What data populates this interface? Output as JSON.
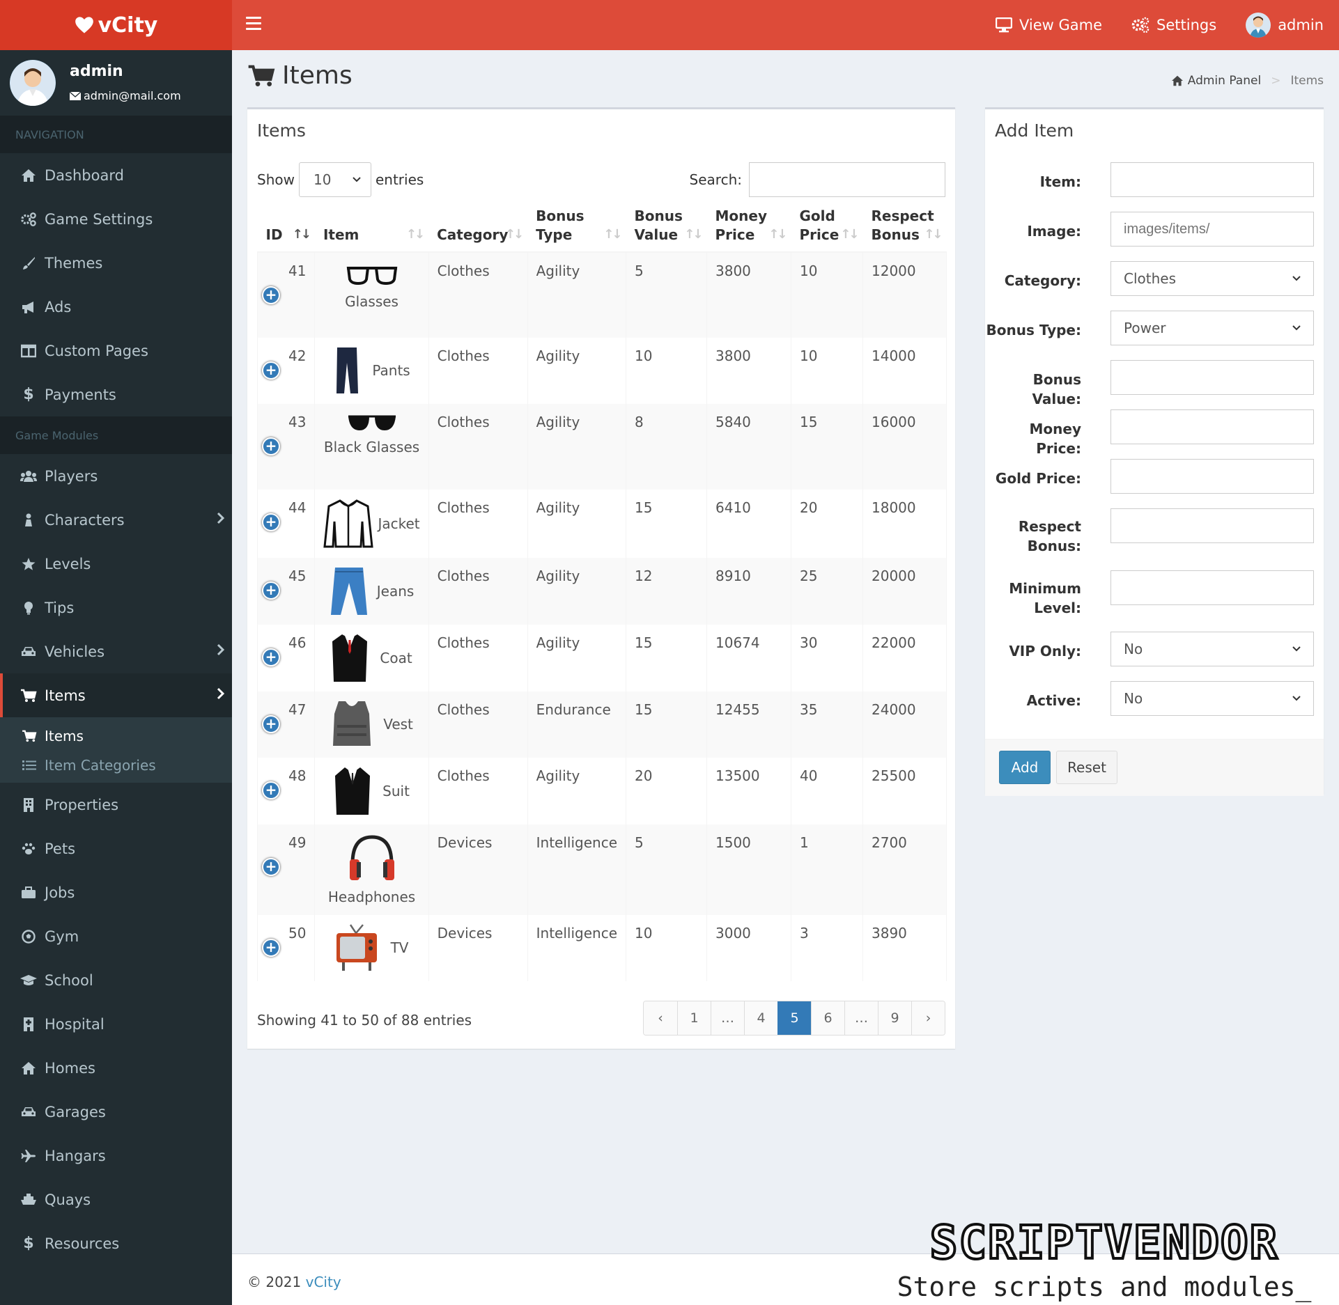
{
  "app": {
    "name": "vCity"
  },
  "topnav": {
    "view_game": "View Game",
    "settings": "Settings",
    "user": "admin"
  },
  "user": {
    "name": "admin",
    "email": "admin@mail.com"
  },
  "sidebar": {
    "nav_header": "NAVIGATION",
    "nav": [
      {
        "label": "Dashboard",
        "icon": "home-icon"
      },
      {
        "label": "Game Settings",
        "icon": "gears-icon"
      },
      {
        "label": "Themes",
        "icon": "brush-icon"
      },
      {
        "label": "Ads",
        "icon": "bullhorn-icon"
      },
      {
        "label": "Custom Pages",
        "icon": "columns-icon"
      },
      {
        "label": "Payments",
        "icon": "dollar-icon"
      }
    ],
    "modules_header": "Game Modules",
    "modules": [
      {
        "label": "Players",
        "icon": "users-icon"
      },
      {
        "label": "Characters",
        "icon": "character-icon"
      },
      {
        "label": "Levels",
        "icon": "star-icon"
      },
      {
        "label": "Tips",
        "icon": "lightbulb-icon"
      },
      {
        "label": "Vehicles",
        "icon": "car-icon"
      },
      {
        "label": "Items",
        "icon": "cart-icon"
      },
      {
        "label": "Properties",
        "icon": "building-icon"
      },
      {
        "label": "Pets",
        "icon": "paw-icon"
      },
      {
        "label": "Jobs",
        "icon": "briefcase-icon"
      },
      {
        "label": "Gym",
        "icon": "ball-icon"
      },
      {
        "label": "School",
        "icon": "graduation-cap-icon"
      },
      {
        "label": "Hospital",
        "icon": "hospital-icon"
      },
      {
        "label": "Homes",
        "icon": "home-icon"
      },
      {
        "label": "Garages",
        "icon": "car-icon"
      },
      {
        "label": "Hangars",
        "icon": "plane-icon"
      },
      {
        "label": "Quays",
        "icon": "ship-icon"
      },
      {
        "label": "Resources",
        "icon": "dollar-icon"
      }
    ],
    "items_sub": [
      {
        "label": "Items",
        "icon": "cart-icon"
      },
      {
        "label": "Item Categories",
        "icon": "list-icon"
      }
    ]
  },
  "page": {
    "title": "Items"
  },
  "breadcrumb": {
    "root": "Admin Panel",
    "current": "Items"
  },
  "table": {
    "title": "Items",
    "show_label": "Show",
    "entries_value": "10",
    "entries_label": "entries",
    "search_label": "Search:",
    "columns": [
      "ID",
      "Item",
      "Category",
      "Bonus Type",
      "Bonus Value",
      "Money Price",
      "Gold Price",
      "Respect Bonus"
    ],
    "rows": [
      {
        "id": "41",
        "item": "Glasses",
        "icon": "glasses-icon",
        "category": "Clothes",
        "bonus_type": "Agility",
        "bonus_value": "5",
        "money": "3800",
        "gold": "10",
        "respect": "12000"
      },
      {
        "id": "42",
        "item": "Pants",
        "icon": "pants-icon",
        "category": "Clothes",
        "bonus_type": "Agility",
        "bonus_value": "10",
        "money": "3800",
        "gold": "10",
        "respect": "14000"
      },
      {
        "id": "43",
        "item": "Black Glasses",
        "icon": "sunglasses-icon",
        "category": "Clothes",
        "bonus_type": "Agility",
        "bonus_value": "8",
        "money": "5840",
        "gold": "15",
        "respect": "16000"
      },
      {
        "id": "44",
        "item": "Jacket",
        "icon": "jacket-icon",
        "category": "Clothes",
        "bonus_type": "Agility",
        "bonus_value": "15",
        "money": "6410",
        "gold": "20",
        "respect": "18000"
      },
      {
        "id": "45",
        "item": "Jeans",
        "icon": "jeans-icon",
        "category": "Clothes",
        "bonus_type": "Agility",
        "bonus_value": "12",
        "money": "8910",
        "gold": "25",
        "respect": "20000"
      },
      {
        "id": "46",
        "item": "Coat",
        "icon": "coat-icon",
        "category": "Clothes",
        "bonus_type": "Agility",
        "bonus_value": "15",
        "money": "10674",
        "gold": "30",
        "respect": "22000"
      },
      {
        "id": "47",
        "item": "Vest",
        "icon": "vest-icon",
        "category": "Clothes",
        "bonus_type": "Endurance",
        "bonus_value": "15",
        "money": "12455",
        "gold": "35",
        "respect": "24000"
      },
      {
        "id": "48",
        "item": "Suit",
        "icon": "suit-icon",
        "category": "Clothes",
        "bonus_type": "Agility",
        "bonus_value": "20",
        "money": "13500",
        "gold": "40",
        "respect": "25500"
      },
      {
        "id": "49",
        "item": "Headphones",
        "icon": "headphones-icon",
        "category": "Devices",
        "bonus_type": "Intelligence",
        "bonus_value": "5",
        "money": "1500",
        "gold": "1",
        "respect": "2700"
      },
      {
        "id": "50",
        "item": "TV",
        "icon": "tv-icon",
        "category": "Devices",
        "bonus_type": "Intelligence",
        "bonus_value": "10",
        "money": "3000",
        "gold": "3",
        "respect": "3890"
      }
    ],
    "info": "Showing 41 to 50 of 88 entries",
    "pages": [
      "‹",
      "1",
      "…",
      "4",
      "5",
      "6",
      "…",
      "9",
      "›"
    ],
    "current_page": "5"
  },
  "form": {
    "title": "Add Item",
    "fields": {
      "item": {
        "label": "Item:",
        "value": ""
      },
      "image": {
        "label": "Image:",
        "placeholder": "images/items/"
      },
      "category": {
        "label": "Category:",
        "value": "Clothes"
      },
      "bonus_type": {
        "label": "Bonus Type:",
        "value": "Power"
      },
      "bonus_value": {
        "label": "Bonus Value:",
        "value": ""
      },
      "money_price": {
        "label": "Money Price:",
        "value": ""
      },
      "gold_price": {
        "label": "Gold Price:",
        "value": ""
      },
      "respect_bonus": {
        "label": "Respect Bonus:",
        "value": ""
      },
      "min_level": {
        "label": "Minimum Level:",
        "value": ""
      },
      "vip_only": {
        "label": "VIP Only:",
        "value": "No"
      },
      "active": {
        "label": "Active:",
        "value": "No"
      }
    },
    "add": "Add",
    "reset": "Reset"
  },
  "footer": {
    "copyright": "© 2021",
    "brand": "vCity"
  },
  "watermark": {
    "line1": "SCRIPTVENDOR",
    "line2": "Store scripts and modules_"
  },
  "colors": {
    "header": "#dd4b39",
    "logo_bg": "#d73925",
    "sidebar": "#222d32",
    "primary": "#3c8dbc"
  }
}
